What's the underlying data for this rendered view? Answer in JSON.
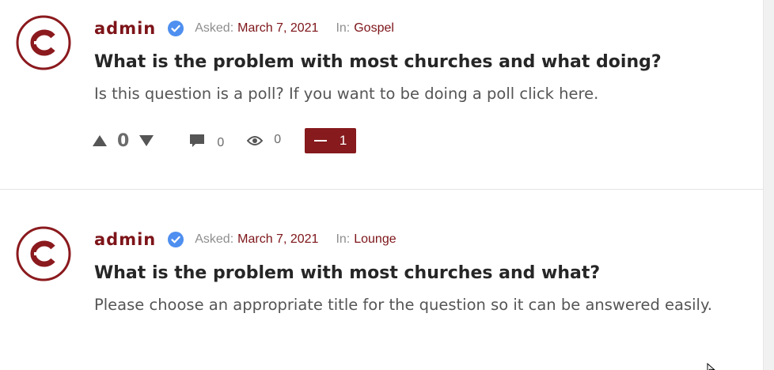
{
  "questions": [
    {
      "author": "admin",
      "asked_label": "Asked:",
      "date": "March 7, 2021",
      "category_label": "In:",
      "category": "Gospel",
      "title": "What is the problem with most churches and what doing?",
      "excerpt": "Is this question is a poll? If you want to be doing a poll click here.",
      "votes": "0",
      "answers": "0",
      "views": "0",
      "poll_count": "1"
    },
    {
      "author": "admin",
      "asked_label": "Asked:",
      "date": "March 7, 2021",
      "category_label": "In:",
      "category": "Lounge",
      "title": "What is the problem with most churches and what?",
      "excerpt": "Please choose an appropriate title for the question so it can be answered easily."
    }
  ],
  "icons": {
    "avatar": "church-logo-icon",
    "verified": "verified-badge-icon",
    "vote_up": "triangle-up-icon",
    "vote_down": "triangle-down-icon",
    "answers": "comment-icon",
    "views": "eye-icon",
    "poll": "minus-icon",
    "cursor": "mouse-cursor-icon"
  },
  "colors": {
    "brand": "#7d1419",
    "button": "#861a1d",
    "verified": "#4e8ff0",
    "text": "#262626",
    "muted": "#8e8e8e"
  }
}
